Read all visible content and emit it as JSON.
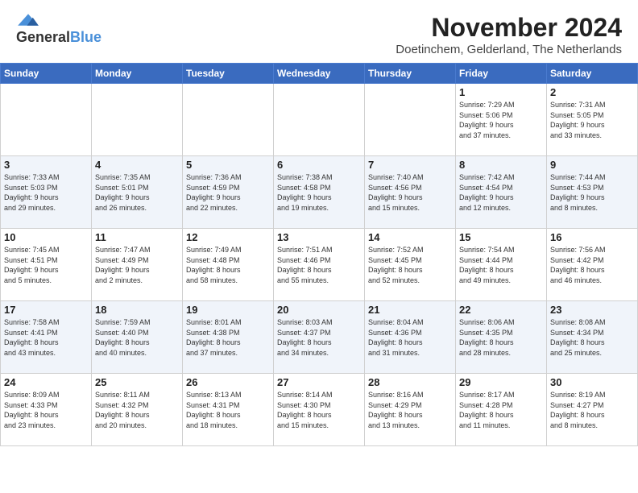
{
  "logo": {
    "general": "General",
    "blue": "Blue"
  },
  "header": {
    "title": "November 2024",
    "subtitle": "Doetinchem, Gelderland, The Netherlands"
  },
  "days_of_week": [
    "Sunday",
    "Monday",
    "Tuesday",
    "Wednesday",
    "Thursday",
    "Friday",
    "Saturday"
  ],
  "weeks": [
    [
      {
        "day": "",
        "info": ""
      },
      {
        "day": "",
        "info": ""
      },
      {
        "day": "",
        "info": ""
      },
      {
        "day": "",
        "info": ""
      },
      {
        "day": "",
        "info": ""
      },
      {
        "day": "1",
        "info": "Sunrise: 7:29 AM\nSunset: 5:06 PM\nDaylight: 9 hours\nand 37 minutes."
      },
      {
        "day": "2",
        "info": "Sunrise: 7:31 AM\nSunset: 5:05 PM\nDaylight: 9 hours\nand 33 minutes."
      }
    ],
    [
      {
        "day": "3",
        "info": "Sunrise: 7:33 AM\nSunset: 5:03 PM\nDaylight: 9 hours\nand 29 minutes."
      },
      {
        "day": "4",
        "info": "Sunrise: 7:35 AM\nSunset: 5:01 PM\nDaylight: 9 hours\nand 26 minutes."
      },
      {
        "day": "5",
        "info": "Sunrise: 7:36 AM\nSunset: 4:59 PM\nDaylight: 9 hours\nand 22 minutes."
      },
      {
        "day": "6",
        "info": "Sunrise: 7:38 AM\nSunset: 4:58 PM\nDaylight: 9 hours\nand 19 minutes."
      },
      {
        "day": "7",
        "info": "Sunrise: 7:40 AM\nSunset: 4:56 PM\nDaylight: 9 hours\nand 15 minutes."
      },
      {
        "day": "8",
        "info": "Sunrise: 7:42 AM\nSunset: 4:54 PM\nDaylight: 9 hours\nand 12 minutes."
      },
      {
        "day": "9",
        "info": "Sunrise: 7:44 AM\nSunset: 4:53 PM\nDaylight: 9 hours\nand 8 minutes."
      }
    ],
    [
      {
        "day": "10",
        "info": "Sunrise: 7:45 AM\nSunset: 4:51 PM\nDaylight: 9 hours\nand 5 minutes."
      },
      {
        "day": "11",
        "info": "Sunrise: 7:47 AM\nSunset: 4:49 PM\nDaylight: 9 hours\nand 2 minutes."
      },
      {
        "day": "12",
        "info": "Sunrise: 7:49 AM\nSunset: 4:48 PM\nDaylight: 8 hours\nand 58 minutes."
      },
      {
        "day": "13",
        "info": "Sunrise: 7:51 AM\nSunset: 4:46 PM\nDaylight: 8 hours\nand 55 minutes."
      },
      {
        "day": "14",
        "info": "Sunrise: 7:52 AM\nSunset: 4:45 PM\nDaylight: 8 hours\nand 52 minutes."
      },
      {
        "day": "15",
        "info": "Sunrise: 7:54 AM\nSunset: 4:44 PM\nDaylight: 8 hours\nand 49 minutes."
      },
      {
        "day": "16",
        "info": "Sunrise: 7:56 AM\nSunset: 4:42 PM\nDaylight: 8 hours\nand 46 minutes."
      }
    ],
    [
      {
        "day": "17",
        "info": "Sunrise: 7:58 AM\nSunset: 4:41 PM\nDaylight: 8 hours\nand 43 minutes."
      },
      {
        "day": "18",
        "info": "Sunrise: 7:59 AM\nSunset: 4:40 PM\nDaylight: 8 hours\nand 40 minutes."
      },
      {
        "day": "19",
        "info": "Sunrise: 8:01 AM\nSunset: 4:38 PM\nDaylight: 8 hours\nand 37 minutes."
      },
      {
        "day": "20",
        "info": "Sunrise: 8:03 AM\nSunset: 4:37 PM\nDaylight: 8 hours\nand 34 minutes."
      },
      {
        "day": "21",
        "info": "Sunrise: 8:04 AM\nSunset: 4:36 PM\nDaylight: 8 hours\nand 31 minutes."
      },
      {
        "day": "22",
        "info": "Sunrise: 8:06 AM\nSunset: 4:35 PM\nDaylight: 8 hours\nand 28 minutes."
      },
      {
        "day": "23",
        "info": "Sunrise: 8:08 AM\nSunset: 4:34 PM\nDaylight: 8 hours\nand 25 minutes."
      }
    ],
    [
      {
        "day": "24",
        "info": "Sunrise: 8:09 AM\nSunset: 4:33 PM\nDaylight: 8 hours\nand 23 minutes."
      },
      {
        "day": "25",
        "info": "Sunrise: 8:11 AM\nSunset: 4:32 PM\nDaylight: 8 hours\nand 20 minutes."
      },
      {
        "day": "26",
        "info": "Sunrise: 8:13 AM\nSunset: 4:31 PM\nDaylight: 8 hours\nand 18 minutes."
      },
      {
        "day": "27",
        "info": "Sunrise: 8:14 AM\nSunset: 4:30 PM\nDaylight: 8 hours\nand 15 minutes."
      },
      {
        "day": "28",
        "info": "Sunrise: 8:16 AM\nSunset: 4:29 PM\nDaylight: 8 hours\nand 13 minutes."
      },
      {
        "day": "29",
        "info": "Sunrise: 8:17 AM\nSunset: 4:28 PM\nDaylight: 8 hours\nand 11 minutes."
      },
      {
        "day": "30",
        "info": "Sunrise: 8:19 AM\nSunset: 4:27 PM\nDaylight: 8 hours\nand 8 minutes."
      }
    ]
  ]
}
